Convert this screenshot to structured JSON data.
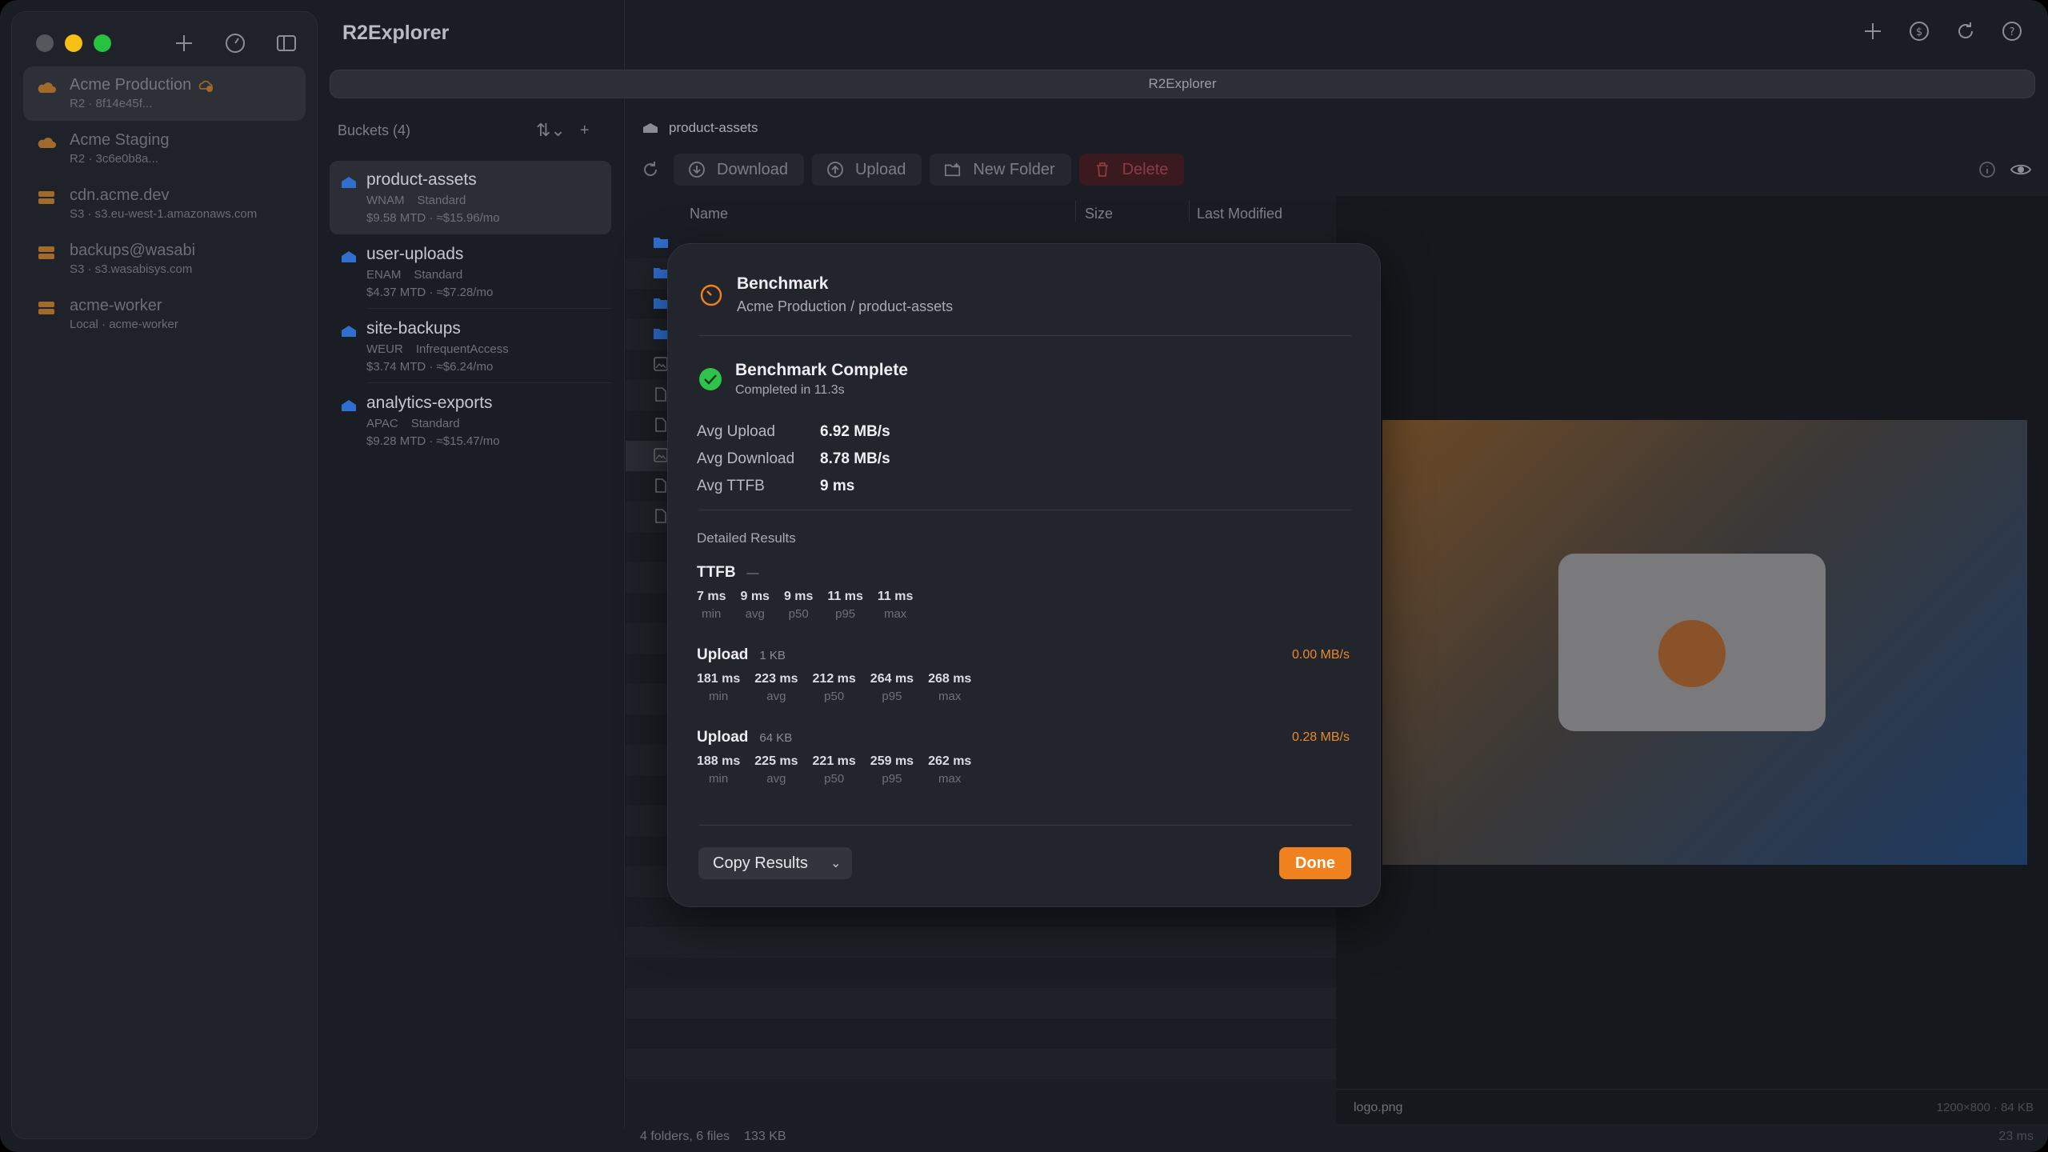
{
  "app": {
    "title": "R2Explorer",
    "address": "R2Explorer"
  },
  "connections": [
    {
      "name": "Acme Production",
      "sub": "R2 · 8f14e45f...",
      "icon": "cloud-icon",
      "color": "#e8892b",
      "active": true,
      "warn": true
    },
    {
      "name": "Acme Staging",
      "sub": "R2 · 3c6e0b8a...",
      "icon": "cloud-icon",
      "color": "#e8892b"
    },
    {
      "name": "cdn.acme.dev",
      "sub": "S3 · s3.eu-west-1.amazonaws.com",
      "icon": "server-icon",
      "color": "#e8892b"
    },
    {
      "name": "backups@wasabi",
      "sub": "S3 · s3.wasabisys.com",
      "icon": "server-icon",
      "color": "#e8892b"
    },
    {
      "name": "acme-worker",
      "sub": "Local · acme-worker",
      "icon": "server-icon",
      "color": "#e8892b"
    }
  ],
  "buckets": {
    "header": "Buckets (4)",
    "items": [
      {
        "name": "product-assets",
        "region": "WNAM",
        "class": "Standard",
        "cost": "$9.58 MTD · ≈$15.96/mo"
      },
      {
        "name": "user-uploads",
        "region": "ENAM",
        "class": "Standard",
        "cost": "$4.37 MTD · ≈$7.28/mo"
      },
      {
        "name": "site-backups",
        "region": "WEUR",
        "class": "InfrequentAccess",
        "cost": "$3.74 MTD · ≈$6.24/mo"
      },
      {
        "name": "analytics-exports",
        "region": "APAC",
        "class": "Standard",
        "cost": "$9.28 MTD · ≈$15.47/mo"
      }
    ]
  },
  "breadcrumb": "product-assets",
  "toolbar": {
    "download": "Download",
    "upload": "Upload",
    "new_folder": "New Folder",
    "delete": "Delete"
  },
  "table": {
    "col_name": "Name",
    "col_size": "Size",
    "col_modified": "Last Modified"
  },
  "preview": {
    "filename": "logo.png",
    "meta": "1200×800 · 84 KB",
    "time": "23 ms"
  },
  "status": {
    "counts": "4 folders, 6 files",
    "size": "133 KB"
  },
  "modal": {
    "title": "Benchmark",
    "subtitle": "Acme Production / product-assets",
    "status_title": "Benchmark Complete",
    "status_sub": "Completed in 11.3s",
    "averages": [
      {
        "label": "Avg Upload",
        "value": "6.92 MB/s"
      },
      {
        "label": "Avg Download",
        "value": "8.78 MB/s"
      },
      {
        "label": "Avg TTFB",
        "value": "9 ms"
      }
    ],
    "detailed_label": "Detailed Results",
    "metrics": [
      {
        "name": "TTFB",
        "size": "—",
        "rate": "",
        "stats": [
          {
            "value": "7 ms",
            "label": "min"
          },
          {
            "value": "9 ms",
            "label": "avg"
          },
          {
            "value": "9 ms",
            "label": "p50"
          },
          {
            "value": "11 ms",
            "label": "p95"
          },
          {
            "value": "11 ms",
            "label": "max"
          }
        ]
      },
      {
        "name": "Upload",
        "size": "1 KB",
        "rate": "0.00 MB/s",
        "stats": [
          {
            "value": "181 ms",
            "label": "min"
          },
          {
            "value": "223 ms",
            "label": "avg"
          },
          {
            "value": "212 ms",
            "label": "p50"
          },
          {
            "value": "264 ms",
            "label": "p95"
          },
          {
            "value": "268 ms",
            "label": "max"
          }
        ]
      },
      {
        "name": "Upload",
        "size": "64 KB",
        "rate": "0.28 MB/s",
        "stats": [
          {
            "value": "188 ms",
            "label": "min"
          },
          {
            "value": "225 ms",
            "label": "avg"
          },
          {
            "value": "221 ms",
            "label": "p50"
          },
          {
            "value": "259 ms",
            "label": "p95"
          },
          {
            "value": "262 ms",
            "label": "max"
          }
        ]
      }
    ],
    "copy_label": "Copy Results",
    "done_label": "Done"
  },
  "colors": {
    "accent": "#f0811f",
    "success": "#2fc34b",
    "folder": "#2f6fd0"
  }
}
